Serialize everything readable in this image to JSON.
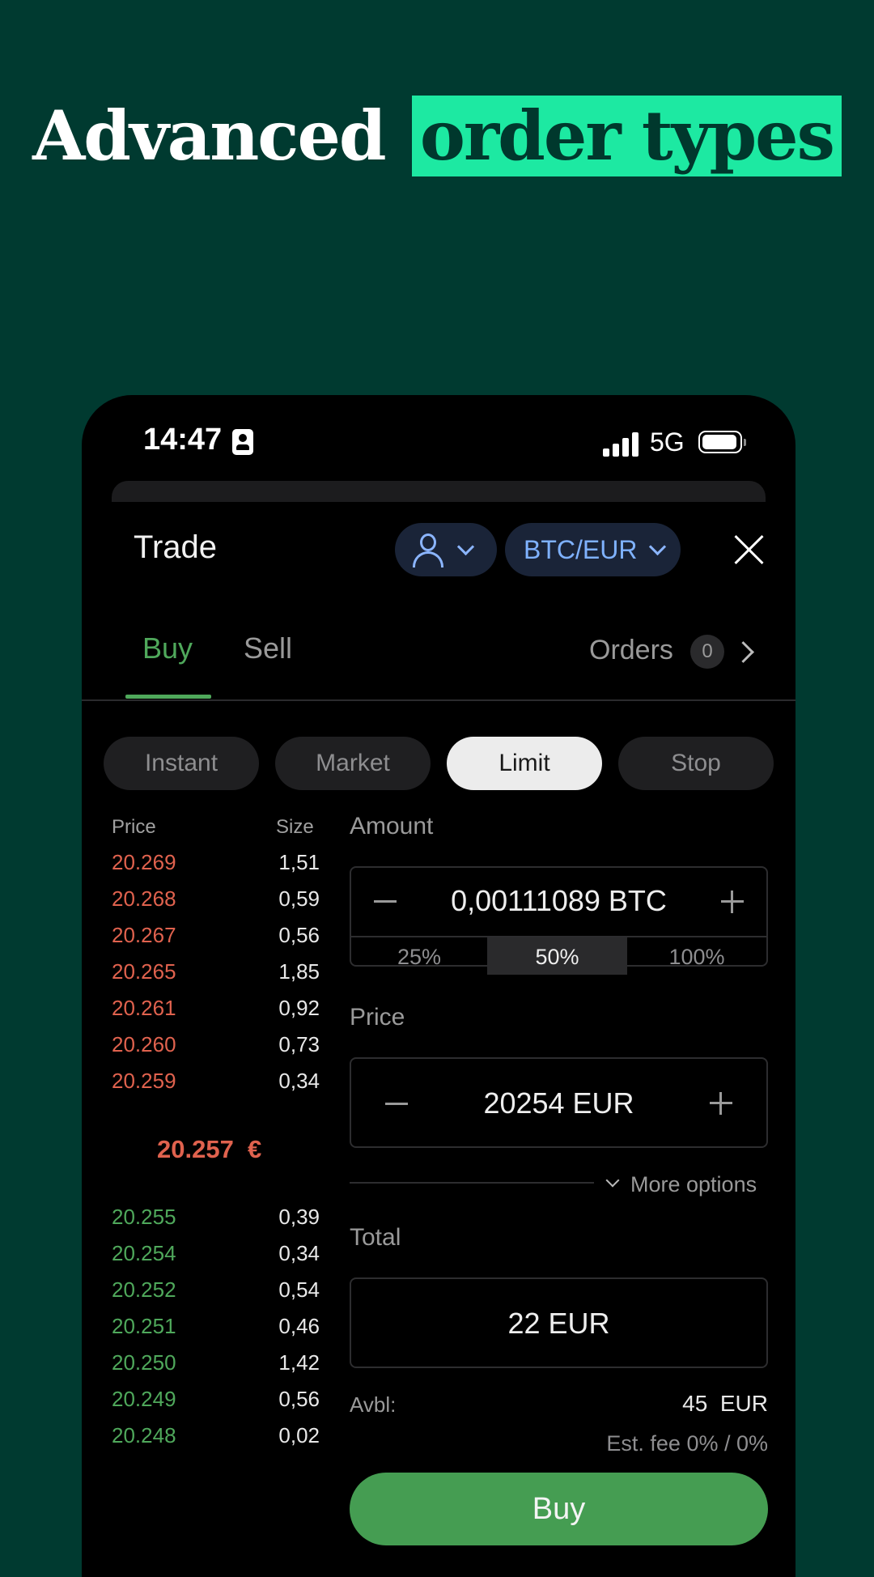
{
  "headline": {
    "part1": "Advanced",
    "part2": "order types"
  },
  "status_bar": {
    "time": "14:47",
    "network": "5G"
  },
  "header": {
    "title": "Trade",
    "pair": "BTC/EUR"
  },
  "tabs": {
    "buy": "Buy",
    "sell": "Sell",
    "orders_label": "Orders",
    "orders_count": "0"
  },
  "order_types": [
    "Instant",
    "Market",
    "Limit",
    "Stop"
  ],
  "order_type_selected": "Limit",
  "order_book": {
    "price_header": "Price",
    "size_header": "Size",
    "asks": [
      {
        "price": "20.269",
        "size": "1,51"
      },
      {
        "price": "20.268",
        "size": "0,59"
      },
      {
        "price": "20.267",
        "size": "0,56"
      },
      {
        "price": "20.265",
        "size": "1,85"
      },
      {
        "price": "20.261",
        "size": "0,92"
      },
      {
        "price": "20.260",
        "size": "0,73"
      },
      {
        "price": "20.259",
        "size": "0,34"
      }
    ],
    "mid_price": "20.257  €",
    "bids": [
      {
        "price": "20.255",
        "size": "0,39"
      },
      {
        "price": "20.254",
        "size": "0,34"
      },
      {
        "price": "20.252",
        "size": "0,54"
      },
      {
        "price": "20.251",
        "size": "0,46"
      },
      {
        "price": "20.250",
        "size": "1,42"
      },
      {
        "price": "20.249",
        "size": "0,56"
      },
      {
        "price": "20.248",
        "size": "0,02"
      }
    ]
  },
  "form": {
    "amount_label": "Amount",
    "amount_value": "0,00111089 BTC",
    "percent_options": [
      "25%",
      "50%",
      "100%"
    ],
    "percent_selected": "50%",
    "price_label": "Price",
    "price_value": "20254 EUR",
    "more_options": "More options",
    "total_label": "Total",
    "total_value": "22 EUR",
    "available_label": "Avbl:",
    "available_value": "45  EUR",
    "fee": "Est. fee 0% / 0%",
    "submit": "Buy"
  },
  "colors": {
    "background": "#003a30",
    "accent": "#1de9a2",
    "buy": "#4fa85b",
    "sell": "#e0624e",
    "pair_pill": "#1a2438"
  }
}
